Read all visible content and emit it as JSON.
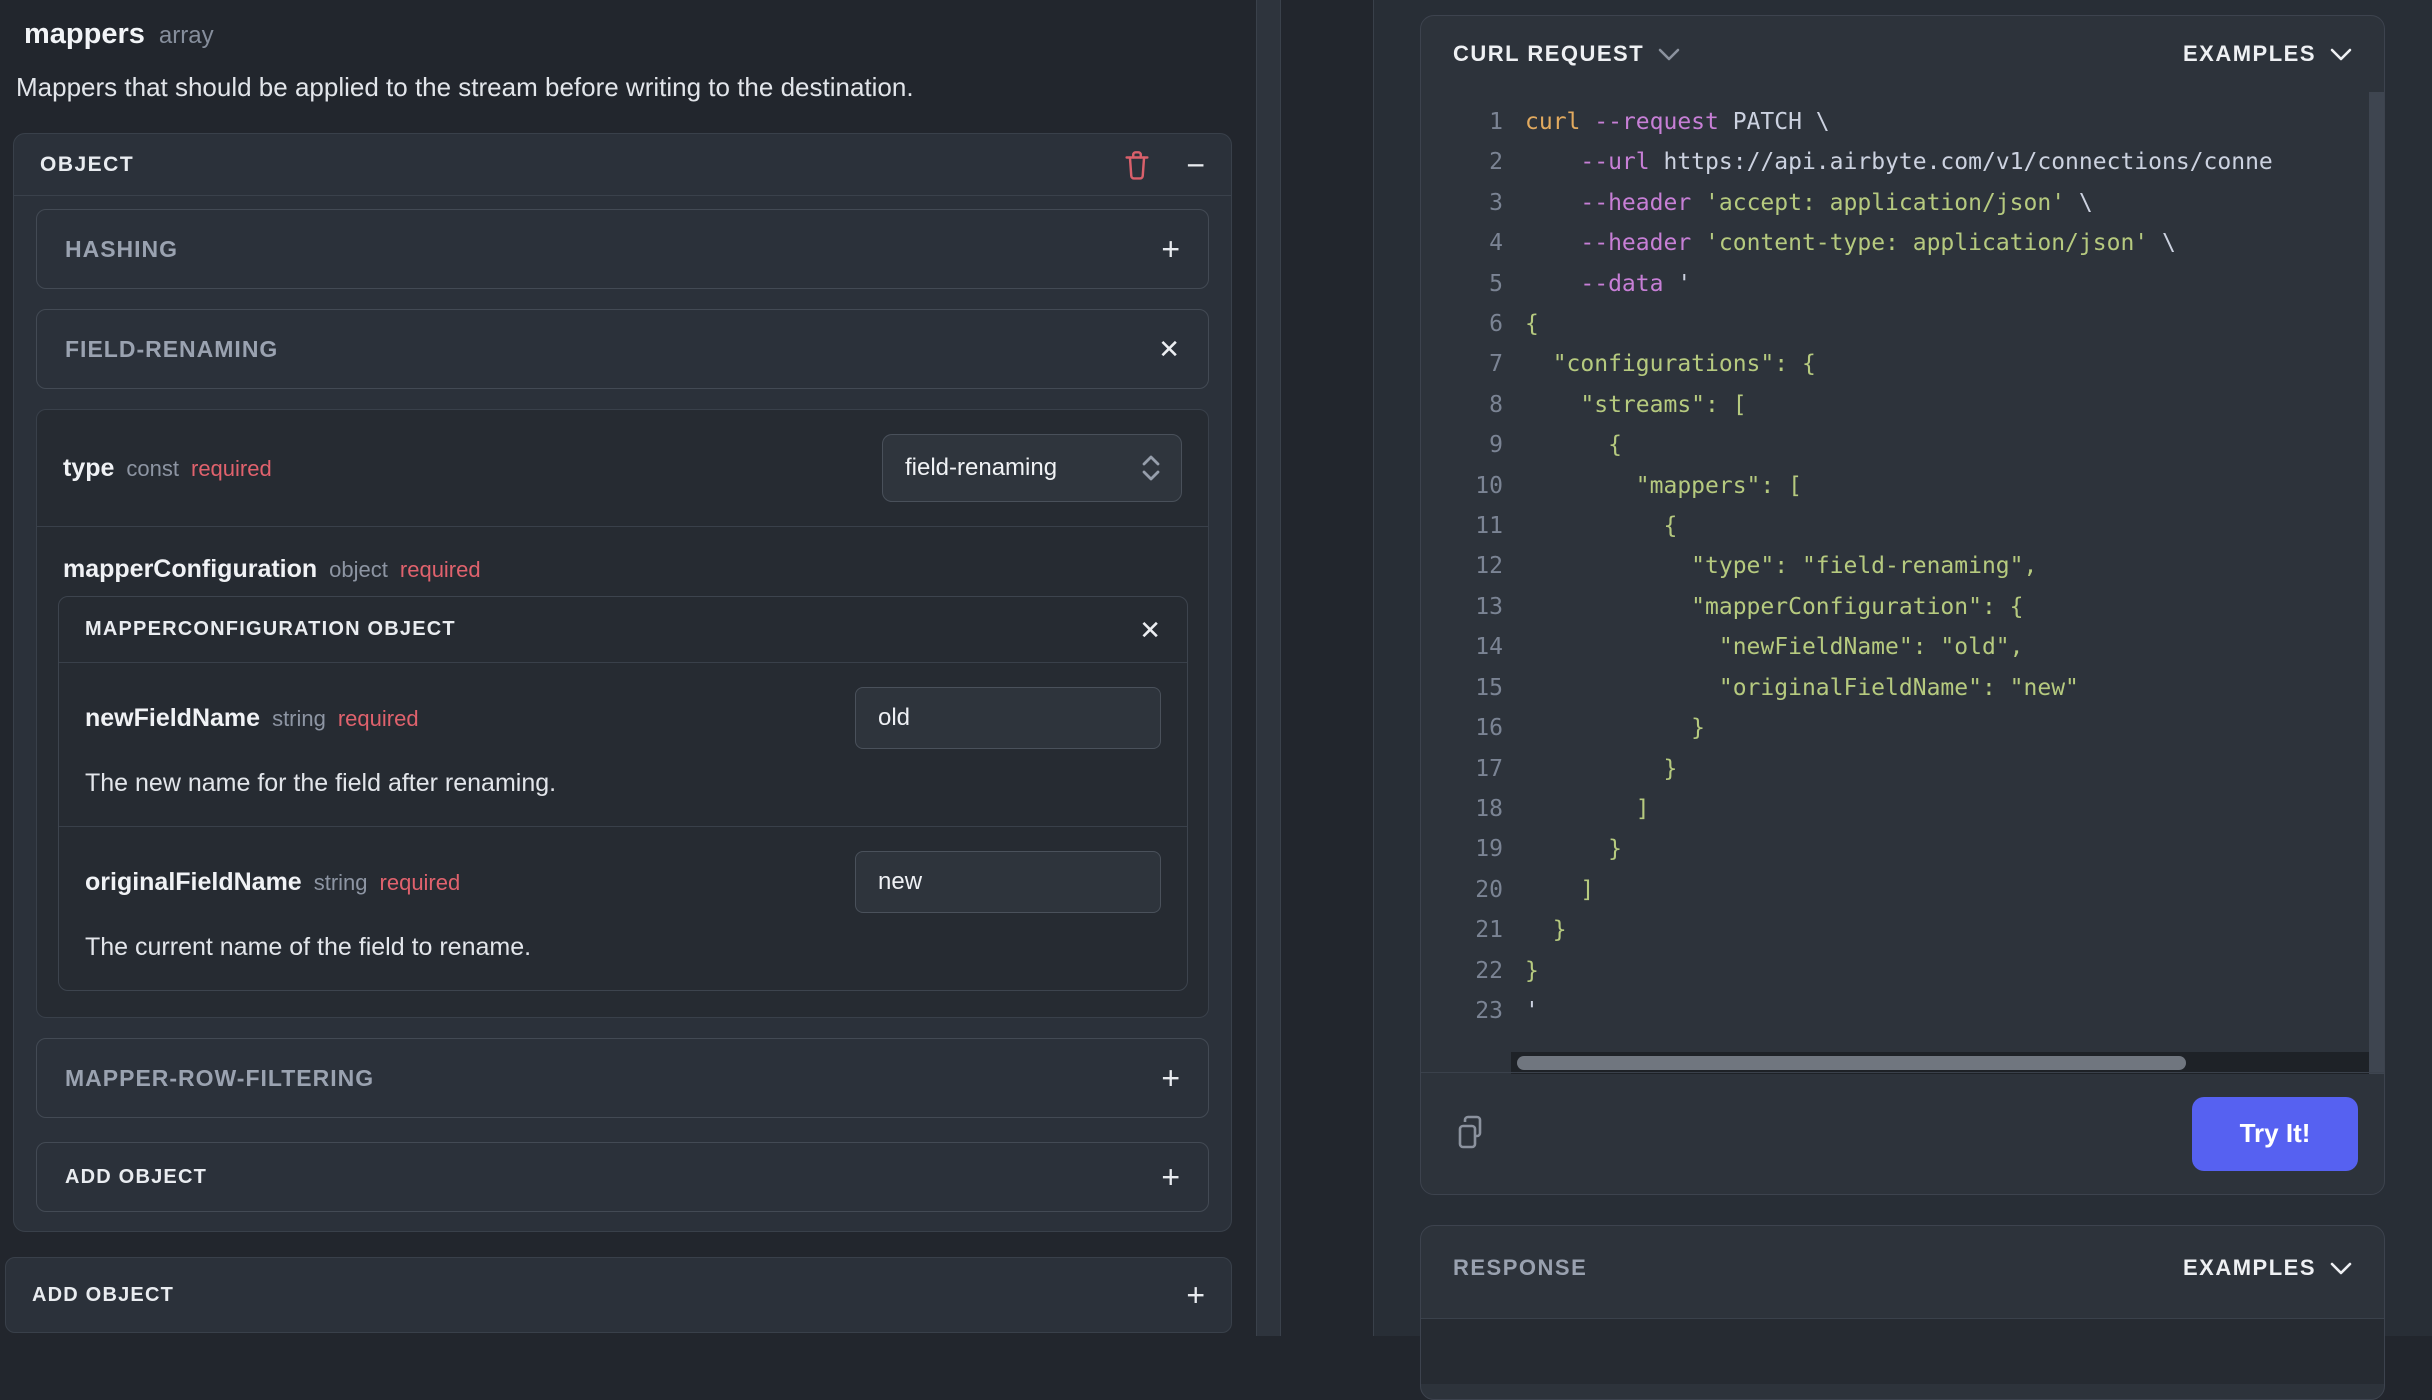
{
  "left": {
    "field_name": "mappers",
    "field_type": "array",
    "description": "Mappers that should be applied to the stream before writing to the destination.",
    "object_panel": {
      "title": "OBJECT",
      "minus_glyph": "−",
      "hashing": {
        "title": "HASHING",
        "plus_glyph": "+"
      },
      "field_renaming": {
        "title": "FIELD-RENAMING",
        "close_glyph": "✕",
        "type_row": {
          "name": "type",
          "meta": "const",
          "required": "required",
          "select_value": "field-renaming"
        },
        "mapper_configuration_row": {
          "name": "mapperConfiguration",
          "meta": "object",
          "required": "required"
        },
        "mapper_configuration_object": {
          "title": "MAPPERCONFIGURATION OBJECT",
          "close_glyph": "✕",
          "fields": [
            {
              "name": "newFieldName",
              "meta": "string",
              "required": "required",
              "value": "old",
              "description": "The new name for the field after renaming."
            },
            {
              "name": "originalFieldName",
              "meta": "string",
              "required": "required",
              "value": "new",
              "description": "The current name of the field to rename."
            }
          ]
        }
      },
      "mapper_row_filtering": {
        "title": "MAPPER-ROW-FILTERING",
        "plus_glyph": "+"
      },
      "add_object": {
        "title": "ADD OBJECT",
        "plus_glyph": "+"
      }
    },
    "add_object_outer": {
      "title": "ADD OBJECT",
      "plus_glyph": "+"
    }
  },
  "right": {
    "curl_panel": {
      "title": "CURL REQUEST",
      "examples_label": "EXAMPLES",
      "try_button": "Try It!",
      "code_lines": [
        [
          [
            "cmd",
            "curl"
          ],
          [
            "plain",
            " "
          ],
          [
            "flag",
            "--request"
          ],
          [
            "plain",
            " PATCH \\"
          ]
        ],
        [
          [
            "plain",
            "    "
          ],
          [
            "flag",
            "--url"
          ],
          [
            "plain",
            " https://api.airbyte.com/v1/connections/conne"
          ]
        ],
        [
          [
            "plain",
            "    "
          ],
          [
            "flag",
            "--header"
          ],
          [
            "plain",
            " "
          ],
          [
            "str",
            "'accept: application/json'"
          ],
          [
            "plain",
            " \\"
          ]
        ],
        [
          [
            "plain",
            "    "
          ],
          [
            "flag",
            "--header"
          ],
          [
            "plain",
            " "
          ],
          [
            "str",
            "'content-type: application/json'"
          ],
          [
            "plain",
            " \\"
          ]
        ],
        [
          [
            "plain",
            "    "
          ],
          [
            "flag",
            "--data"
          ],
          [
            "plain",
            " '"
          ]
        ],
        [
          [
            "str",
            "{"
          ]
        ],
        [
          [
            "str",
            "  \"configurations\": {"
          ]
        ],
        [
          [
            "str",
            "    \"streams\": ["
          ]
        ],
        [
          [
            "str",
            "      {"
          ]
        ],
        [
          [
            "str",
            "        \"mappers\": ["
          ]
        ],
        [
          [
            "str",
            "          {"
          ]
        ],
        [
          [
            "str",
            "            \"type\": \"field-renaming\","
          ]
        ],
        [
          [
            "str",
            "            \"mapperConfiguration\": {"
          ]
        ],
        [
          [
            "str",
            "              \"newFieldName\": \"old\","
          ]
        ],
        [
          [
            "str",
            "              \"originalFieldName\": \"new\""
          ]
        ],
        [
          [
            "str",
            "            }"
          ]
        ],
        [
          [
            "str",
            "          }"
          ]
        ],
        [
          [
            "str",
            "        ]"
          ]
        ],
        [
          [
            "str",
            "      }"
          ]
        ],
        [
          [
            "str",
            "    ]"
          ]
        ],
        [
          [
            "str",
            "  }"
          ]
        ],
        [
          [
            "str",
            "}"
          ]
        ],
        [
          [
            "plain",
            "'"
          ]
        ]
      ]
    },
    "response_panel": {
      "title": "RESPONSE",
      "examples_label": "EXAMPLES"
    }
  },
  "colors": {
    "page_bg": "#22262d",
    "panel_bg": "#2b313a",
    "inset_bg": "#262b32",
    "required_red": "#e0626d",
    "trash_red": "#d9606b",
    "try_button_indigo": "#5661f1",
    "code_command_orange": "#e2aa5f",
    "code_flag_purple": "#c77fd6",
    "code_string_green": "#b6ca7f",
    "code_line_number": "#7b8494"
  }
}
